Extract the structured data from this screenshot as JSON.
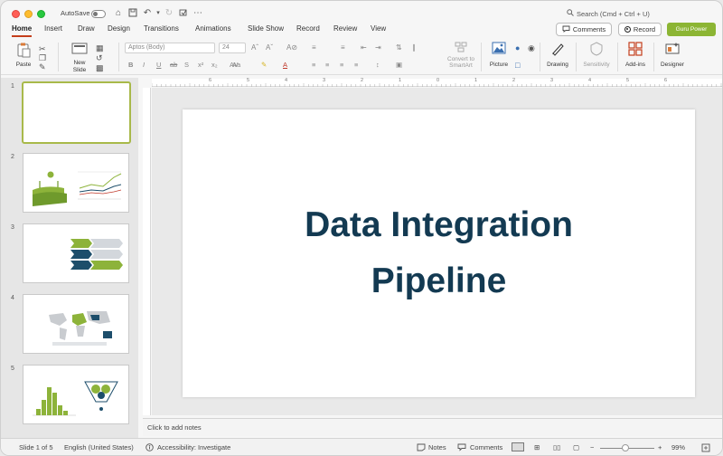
{
  "titlebar": {
    "autosave_label": "AutoSave",
    "search_placeholder": "Search (Cmd + Ctrl + U)"
  },
  "tabs": [
    "Home",
    "Insert",
    "Draw",
    "Design",
    "Transitions",
    "Animations",
    "Slide Show",
    "Record",
    "Review",
    "View"
  ],
  "active_tab": "Home",
  "actions": {
    "comments_label": "Comments",
    "record_label": "Record",
    "guru_label": "Guru Power"
  },
  "ribbon": {
    "paste_label": "Paste",
    "new_slide_label": "New\nSlide",
    "font_name": "Aptos (Body)",
    "font_size": "24",
    "convert_label": "Convert to\nSmartArt",
    "picture_label": "Picture",
    "drawing_label": "Drawing",
    "sensitivity_label": "Sensitivity",
    "addins_label": "Add-ins",
    "designer_label": "Designer"
  },
  "ruler_numbers": [
    "6",
    "5",
    "4",
    "3",
    "2",
    "1",
    "0",
    "1",
    "2",
    "3",
    "4",
    "5",
    "6"
  ],
  "thumbnails": [
    {
      "number": "1",
      "selected": true
    },
    {
      "number": "2",
      "selected": false
    },
    {
      "number": "3",
      "selected": false
    },
    {
      "number": "4",
      "selected": false
    },
    {
      "number": "5",
      "selected": false
    }
  ],
  "slide": {
    "title_line1": "Data Integration",
    "title_line2": "Pipeline"
  },
  "notes_placeholder": "Click to add notes",
  "status": {
    "slide_counter": "Slide 1 of 5",
    "language": "English (United States)",
    "accessibility": "Accessibility: Investigate",
    "notes_label": "Notes",
    "comments_label": "Comments",
    "zoom": "99%"
  },
  "colors": {
    "accent_green": "#8cb534",
    "title_navy": "#133a52",
    "tab_underline": "#c43e1c",
    "slide_green": "#8db33a",
    "slide_navy": "#1d4e6b"
  }
}
